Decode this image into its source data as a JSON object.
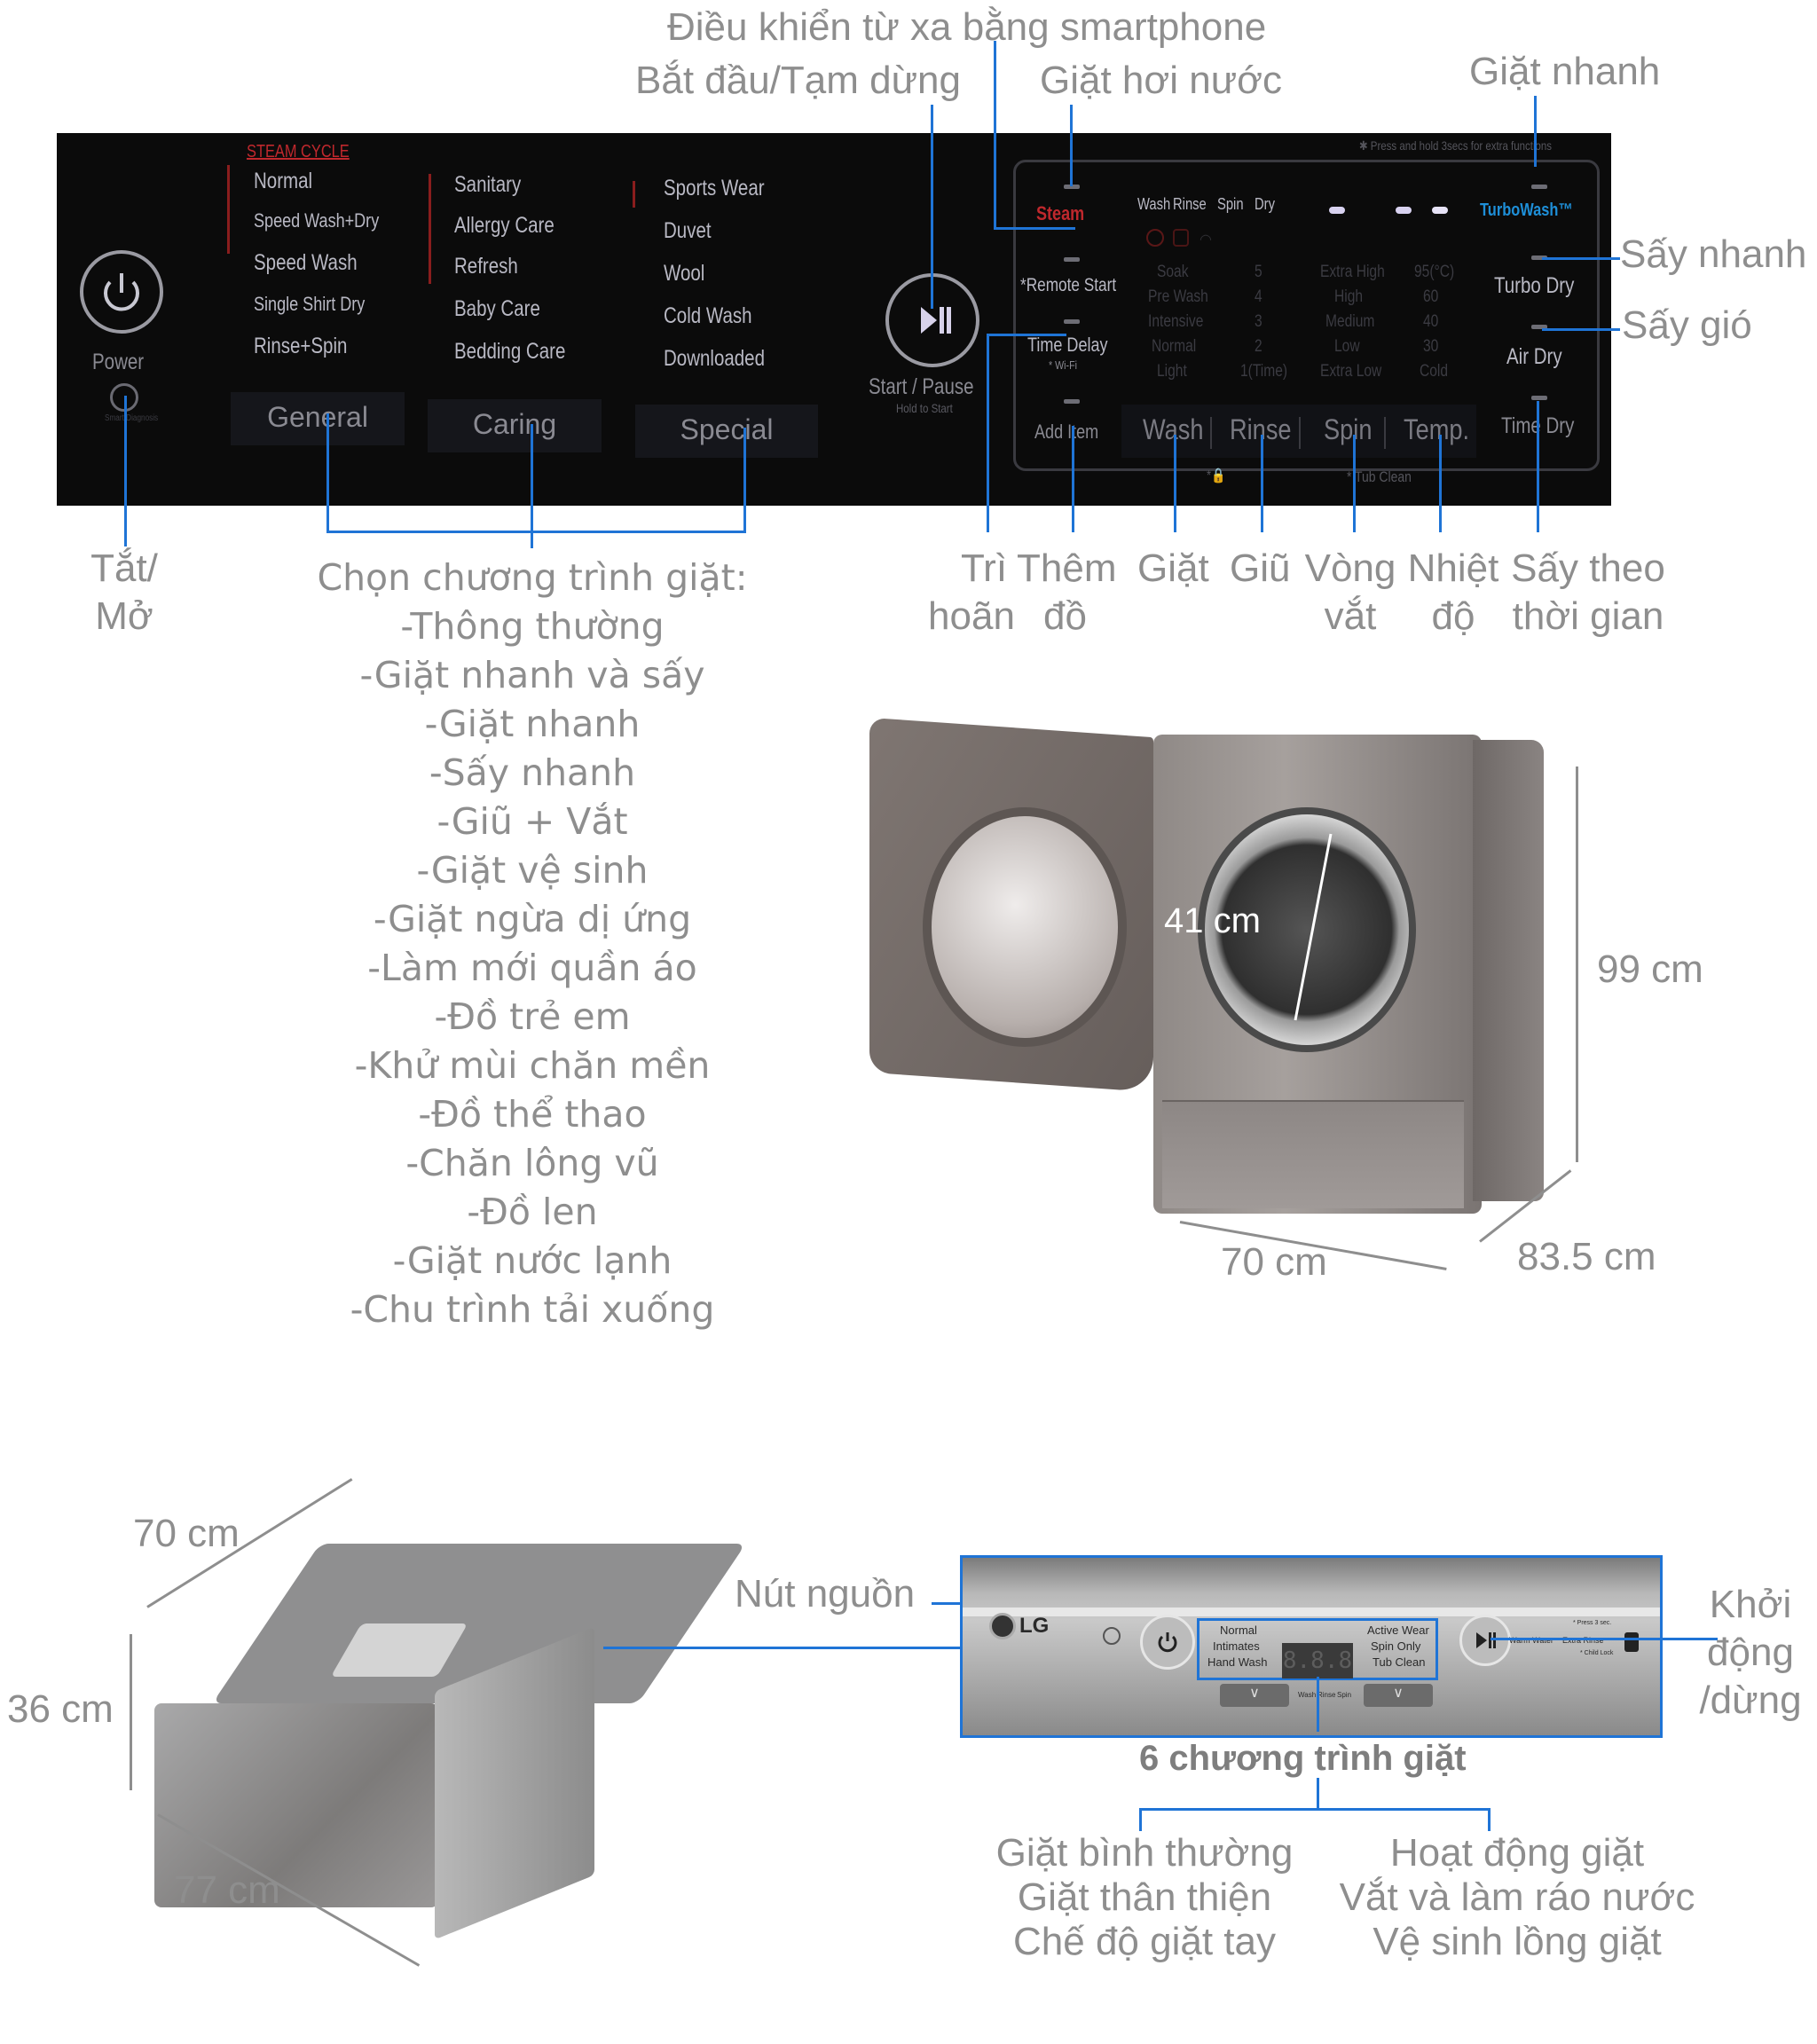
{
  "top_callouts": {
    "remote_control": "Điều khiển từ xa bằng smartphone",
    "start_pause": "Bắt đầu/Tạm dừng",
    "steam_wash": "Giặt hơi nước",
    "quick_wash": "Giặt nhanh",
    "quick_dry": "Sấy nhanh",
    "air_dry": "Sấy gió"
  },
  "main_panel": {
    "steam_cycle_label": "STEAM CYCLE",
    "power_label": "Power",
    "smart_diagnosis_label": "Smart Diagnosis",
    "general_programs": [
      "Normal",
      "Speed Wash+Dry",
      "Speed Wash",
      "Single Shirt Dry",
      "Rinse+Spin"
    ],
    "caring_programs": [
      "Sanitary",
      "Allergy Care",
      "Refresh",
      "Baby Care",
      "Bedding Care"
    ],
    "special_programs": [
      "Sports Wear",
      "Duvet",
      "Wool",
      "Cold Wash",
      "Downloaded"
    ],
    "groups": [
      "General",
      "Caring",
      "Special"
    ],
    "start_pause_label": "Start / Pause",
    "hold_to_start": "Hold to Start",
    "press_hold_note": "✱ Press and hold 3secs for extra functions",
    "steam_label": "Steam",
    "remote_start": "*Remote Start",
    "time_delay": "Time Delay",
    "wifi": "* Wi-Fi",
    "add_item": "Add Item",
    "stage_labels": [
      "Wash",
      "Rinse",
      "Spin",
      "Dry"
    ],
    "wash_levels": [
      "Soak",
      "Pre Wash",
      "Intensive",
      "Normal",
      "Light"
    ],
    "rinse_levels": [
      "5",
      "4",
      "3",
      "2",
      "1(Time)"
    ],
    "spin_levels": [
      "Extra High",
      "High",
      "Medium",
      "Low",
      "Extra Low"
    ],
    "temp_levels": [
      "95(°C)",
      "60",
      "40",
      "30",
      "Cold"
    ],
    "option_buttons": [
      "Wash",
      "Rinse",
      "Spin",
      "Temp."
    ],
    "turbo_wash": "TurboWash™",
    "turbo_dry": "Turbo Dry",
    "air_dry": "Air Dry",
    "time_dry": "Time Dry",
    "tub_clean": "* Tub Clean",
    "child_lock_symbol": "*🔒"
  },
  "bottom_callouts": {
    "power_on_off": [
      "Tắt/",
      "Mở"
    ],
    "delay": [
      "Trì",
      "hoãn"
    ],
    "add_item": [
      "Thêm",
      "đồ"
    ],
    "wash": [
      "Giặt"
    ],
    "rinse": [
      "Giũ"
    ],
    "spin": [
      "Vòng",
      "vắt"
    ],
    "temp": [
      "Nhiệt",
      "độ"
    ],
    "time_dry": [
      "Sấy theo",
      "thời gian"
    ]
  },
  "program_list": {
    "title": "Chọn chương trình giặt:",
    "items": [
      "-Thông thường",
      "-Giặt nhanh và sấy",
      "-Giặt nhanh",
      "-Sấy nhanh",
      "-Giũ + Vắt",
      "-Giặt vệ sinh",
      "-Giặt ngừa dị ứng",
      "-Làm mới quần áo",
      "-Đồ trẻ em",
      "-Khử mùi chăn mền",
      "-Đồ thể thao",
      "-Chăn lông vũ",
      "-Đồ len",
      "-Giặt nước lạnh",
      "-Chu trình tải xuống"
    ]
  },
  "main_machine_dims": {
    "door_diameter": "41 cm",
    "height": "99 cm",
    "width": "70 cm",
    "depth": "83.5 cm"
  },
  "mini_machine_dims": {
    "width": "70 cm",
    "height": "36 cm",
    "depth": "77 cm"
  },
  "mini_panel": {
    "power_button_label": "Nút nguồn",
    "start_stop_label": [
      "Khởi",
      "động",
      "/dừng"
    ],
    "brand": "LG",
    "left_programs": [
      "Normal",
      "Intimates",
      "Hand Wash"
    ],
    "right_programs": [
      "Active Wear",
      "Spin Only",
      "Tub Clean"
    ],
    "display": "8.8.8",
    "stage_icons": [
      "Wash",
      "Rinse",
      "Spin"
    ],
    "extra_labels": [
      "Warm Water",
      "Extra Rinse"
    ],
    "notes": [
      "* Press 3 sec.",
      "* Child Lock"
    ],
    "programs_count_label": "6 chương trình giặt",
    "left_group": [
      "Giặt bình thường",
      "Giặt thân thiện",
      "Chế độ giặt tay"
    ],
    "right_group": [
      "Hoạt động giặt",
      "Vắt và làm ráo nước",
      "Vệ sinh lồng giặt"
    ]
  },
  "colors": {
    "callout_line": "#1f74d6",
    "panel_bg": "#0b0b0b",
    "steam_red": "#c0282d",
    "turbo_blue": "#1e8fd8",
    "label_gray": "#8e8e8e"
  }
}
